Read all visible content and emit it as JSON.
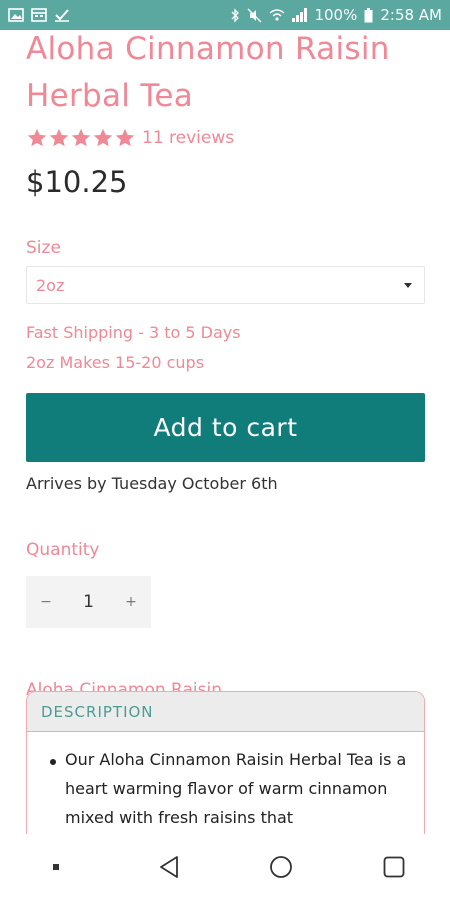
{
  "status_bar": {
    "left_icons": [
      "image-icon",
      "calendar-icon",
      "check-icon"
    ],
    "battery": "100%",
    "time": "2:58 AM"
  },
  "product": {
    "title": "Aloha Cinnamon Raisin Herbal Tea",
    "rating": 5,
    "reviews": "11 reviews",
    "price": "$10.25"
  },
  "size": {
    "label": "Size",
    "selected": "2oz"
  },
  "info": {
    "shipping": "Fast Shipping - 3 to 5 Days",
    "yield": "2oz Makes 15-20 cups"
  },
  "cart": {
    "button_label": "Add to cart",
    "arrives": "Arrives by Tuesday October 6th"
  },
  "quantity": {
    "label": "Quantity",
    "minus": "−",
    "value": "1",
    "plus": "+"
  },
  "subtitle": "Aloha Cinnamon Raisin",
  "description": {
    "heading": "DESCRIPTION",
    "text": "Our Aloha Cinnamon Raisin Herbal Tea is a heart warming flavor of warm cinnamon mixed with fresh raisins that"
  },
  "colors": {
    "accent_pink": "#f08896",
    "button_teal": "#117d7a",
    "status_bar": "#5aa89f"
  }
}
